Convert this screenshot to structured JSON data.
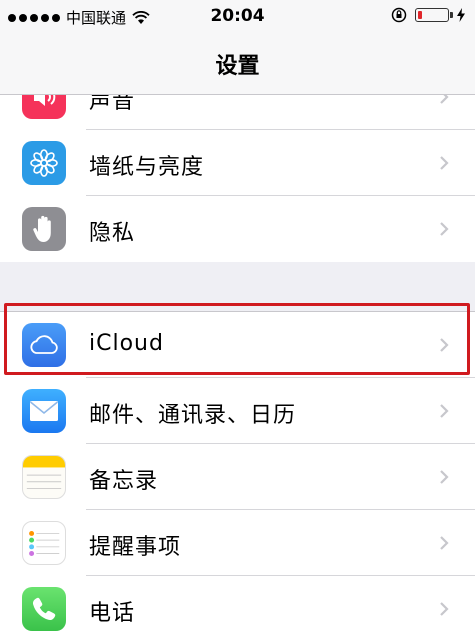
{
  "status_bar": {
    "carrier": "中国联通",
    "time": "20:04",
    "battery_level": 0.15,
    "battery_color": "#e0262b"
  },
  "nav": {
    "title": "设置"
  },
  "groups": [
    {
      "items": [
        {
          "label": "声音",
          "icon": "speaker-icon",
          "color": "#f5325a"
        },
        {
          "label": "墙纸与亮度",
          "icon": "flower-icon",
          "color": "#2b9be6"
        },
        {
          "label": "隐私",
          "icon": "hand-icon",
          "color": "#8e8e93"
        }
      ]
    },
    {
      "items": [
        {
          "label": "iCloud",
          "icon": "cloud-icon",
          "color": "#3a8ef6"
        },
        {
          "label": "邮件、通讯录、日历",
          "icon": "mail-icon",
          "color": "#1e90ff"
        },
        {
          "label": "备忘录",
          "icon": "notes-icon",
          "color": "#ffcc00"
        },
        {
          "label": "提醒事项",
          "icon": "reminders-icon",
          "color": "#ffffff"
        },
        {
          "label": "电话",
          "icon": "phone-icon",
          "color": "#4cd964"
        }
      ]
    }
  ],
  "highlight_color": "#d01a1f"
}
